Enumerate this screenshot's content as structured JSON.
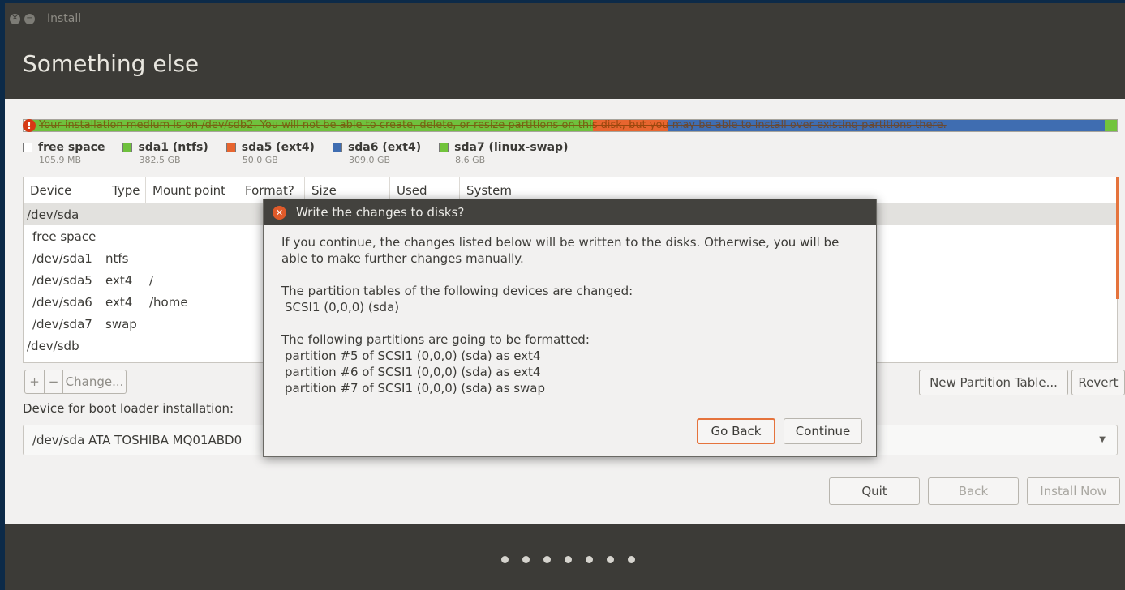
{
  "window": {
    "title": "Install",
    "heading": "Something else"
  },
  "colors": {
    "free": "#ffffff",
    "sda1": "#6fc13d",
    "sda5": "#e8652f",
    "sda6": "#3f6db1",
    "sda7": "#72c43c",
    "accent": "#e5733c"
  },
  "partition_bar": {
    "warning": "Your installation medium is on /dev/sdb2. You will not be able to create, delete, or resize partitions on this disk, but you may be able to install over existing partitions there.",
    "legend": [
      {
        "name": "free space",
        "size": "105.9 MB",
        "color": "#ffffff"
      },
      {
        "name": "sda1 (ntfs)",
        "size": "382.5 GB",
        "color": "#6fc13d"
      },
      {
        "name": "sda5 (ext4)",
        "size": "50.0 GB",
        "color": "#e8652f"
      },
      {
        "name": "sda6 (ext4)",
        "size": "309.0 GB",
        "color": "#3f6db1"
      },
      {
        "name": "sda7 (linux-swap)",
        "size": "8.6 GB",
        "color": "#72c43c"
      }
    ]
  },
  "table": {
    "columns": [
      "Device",
      "Type",
      "Mount point",
      "Format?",
      "Size",
      "Used",
      "System"
    ],
    "rows": [
      {
        "device": "/dev/sda",
        "type": "",
        "mount": ""
      },
      {
        "device": "free space",
        "type": "",
        "mount": ""
      },
      {
        "device": "/dev/sda1",
        "type": "ntfs",
        "mount": ""
      },
      {
        "device": "/dev/sda5",
        "type": "ext4",
        "mount": "/"
      },
      {
        "device": "/dev/sda6",
        "type": "ext4",
        "mount": "/home"
      },
      {
        "device": "/dev/sda7",
        "type": "swap",
        "mount": ""
      },
      {
        "device": "/dev/sdb",
        "type": "",
        "mount": ""
      }
    ]
  },
  "toolbar": {
    "add": "+",
    "remove": "−",
    "change": "Change...",
    "new_table": "New Partition Table...",
    "revert": "Revert"
  },
  "boot": {
    "label": "Device for boot loader installation:",
    "value": "/dev/sda   ATA TOSHIBA MQ01ABD0"
  },
  "nav": {
    "quit": "Quit",
    "back": "Back",
    "install": "Install Now"
  },
  "dialog": {
    "title": "Write the changes to disks?",
    "intro_1": "If you continue, the changes listed below will be written to the disks. Otherwise, you will be",
    "intro_2": "able to make further changes manually.",
    "tables_heading": "The partition tables of the following devices are changed:",
    "tables_item": "SCSI1 (0,0,0) (sda)",
    "format_heading": "The following partitions are going to be formatted:",
    "format_items": [
      "partition #5 of SCSI1 (0,0,0) (sda) as ext4",
      "partition #6 of SCSI1 (0,0,0) (sda) as ext4",
      "partition #7 of SCSI1 (0,0,0) (sda) as swap"
    ],
    "go_back": "Go Back",
    "continue": "Continue"
  },
  "progress": {
    "steps": 7
  }
}
